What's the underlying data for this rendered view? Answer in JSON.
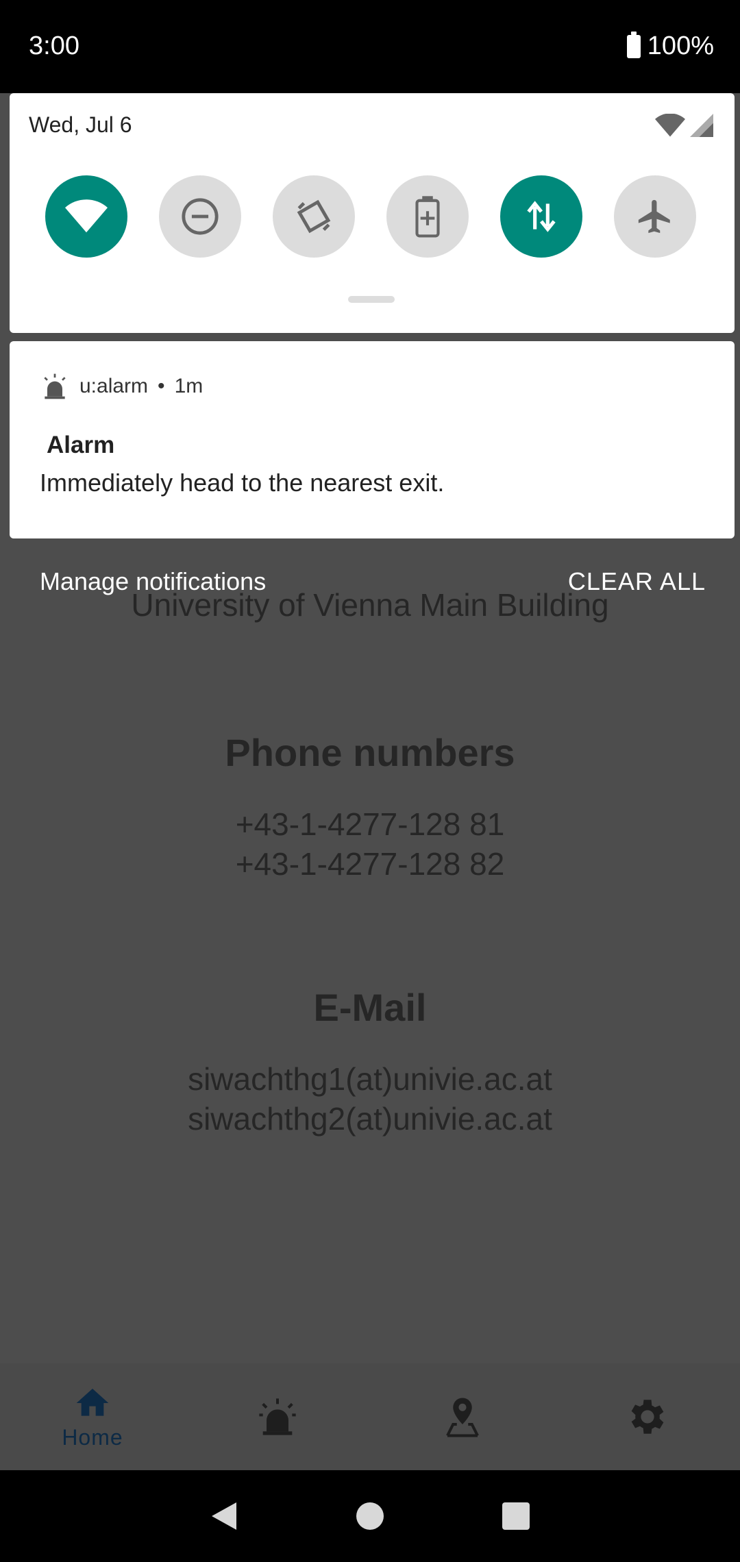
{
  "status_bar": {
    "time": "3:00",
    "battery": "100%"
  },
  "quick_settings": {
    "date": "Wed, Jul 6",
    "tiles": [
      {
        "name": "wifi",
        "active": true
      },
      {
        "name": "do-not-disturb",
        "active": false
      },
      {
        "name": "auto-rotate",
        "active": false
      },
      {
        "name": "battery-saver",
        "active": false
      },
      {
        "name": "mobile-data",
        "active": true
      },
      {
        "name": "airplane-mode",
        "active": false
      }
    ]
  },
  "notification": {
    "app": "u:alarm",
    "separator": "•",
    "time": "1m",
    "title": "Alarm",
    "text": "Immediately head to the nearest exit."
  },
  "notification_actions": {
    "manage": "Manage notifications",
    "clear_all": "CLEAR ALL"
  },
  "app": {
    "building": "University of Vienna Main Building",
    "phone_title": "Phone numbers",
    "phones": [
      "+43-1-4277-128 81",
      "+43-1-4277-128 82"
    ],
    "email_title": "E-Mail",
    "emails": [
      "siwachthg1(at)univie.ac.at",
      "siwachthg2(at)univie.ac.at"
    ]
  },
  "bottom_nav": {
    "items": [
      {
        "label": "Home",
        "icon": "home-icon"
      },
      {
        "label": "",
        "icon": "alarm-light-icon"
      },
      {
        "label": "",
        "icon": "map-pin-icon"
      },
      {
        "label": "",
        "icon": "gear-icon"
      }
    ]
  },
  "colors": {
    "accent": "#00897b",
    "dim_bg": "#4d4d4d",
    "nav_active": "#0d2a45"
  }
}
